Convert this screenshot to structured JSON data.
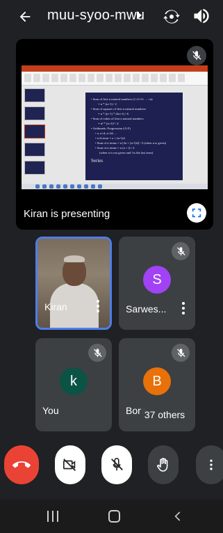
{
  "header": {
    "meeting_code": "muu-syoo-mwu"
  },
  "presentation": {
    "label": "Kiran is presenting",
    "slide": {
      "lines": [
        "• Sum of first n natural numbers (1+2+3+ ... +n)",
        "= n * (n+1) / 2",
        "• Sum of squares of first n natural numbers",
        "= n * (n+1) * (2n+1) / 6",
        "• Sum of cubes of first n natural numbers",
        "= n² * (n+1)² / 4",
        "• Arithmetic Progression (A.P.)",
        "• a, a+d, a+2d, ...",
        "• n th term = a + (n-1)d",
        "• Sum of n terms = n [2a + (n-1)d] / 2  (when n is given)",
        "• Sum of n terms = n (a + l) / 2",
        "(when n is not given and l is the last term)"
      ],
      "footer": "Series"
    }
  },
  "participants": [
    {
      "name": "Kiran",
      "muted": false,
      "video": true
    },
    {
      "name": "Sarwes...",
      "initial": "S",
      "avatar_color": "#a142f4",
      "muted": true
    },
    {
      "name": "You",
      "initial": "k",
      "avatar_color": "#0b5345",
      "muted": true
    },
    {
      "name": "Bora",
      "initial": "B",
      "avatar_color": "#e8710a",
      "muted": true
    }
  ],
  "others_pill": "37 others",
  "colors": {
    "background": "#202124",
    "tile": "#3c4043",
    "end_call": "#ea4335",
    "active_speaker_border": "#4d7ee8"
  }
}
